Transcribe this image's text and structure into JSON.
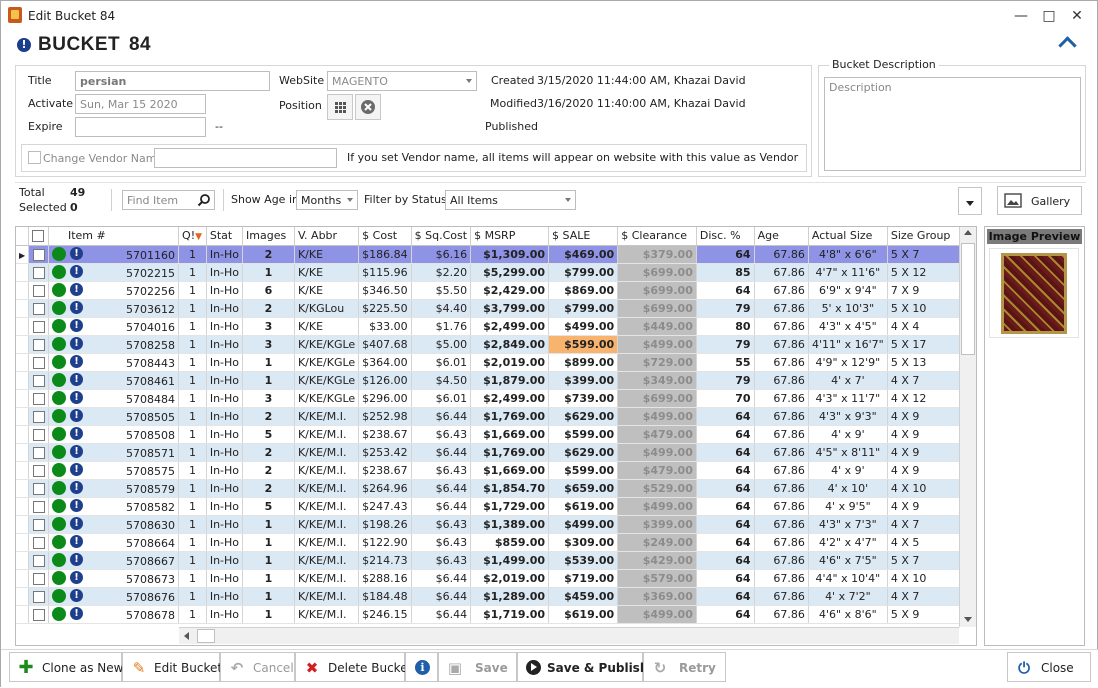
{
  "window": {
    "title": "Edit Bucket 84",
    "controls": [
      "—",
      "□",
      "✕"
    ]
  },
  "header": {
    "title": "BUCKET",
    "number": "84"
  },
  "form": {
    "title_label": "Title",
    "title_value": "persian",
    "activate_label": "Activate",
    "activate_value": "Sun, Mar 15 2020",
    "expire_label": "Expire",
    "expire_suffix": "--",
    "website_label": "WebSite",
    "website_value": "MAGENTO",
    "position_label": "Position",
    "created_label": "Created",
    "created_value": "3/15/2020 11:44:00 AM, Khazai David",
    "modified_label": "Modified",
    "modified_value": "3/16/2020 11:40:00 AM, Khazai David",
    "published_label": "Published",
    "change_vendor_label": "Change Vendor Name",
    "vendor_note": "If you set Vendor name, all items will appear on website with this value as Vendor",
    "description_group": "Bucket Description",
    "description_placeholder": "Description"
  },
  "toolbar": {
    "total_label": "Total",
    "total_value": "49",
    "selected_label": "Selected",
    "selected_value": "0",
    "find_placeholder": "Find Item",
    "show_age_label": "Show Age in",
    "age_unit": "Months",
    "filter_label": "Filter by Status",
    "filter_value": "All Items",
    "gallery_label": "Gallery"
  },
  "grid": {
    "columns": [
      "Item #",
      "Q!",
      "Stat",
      "Images",
      "V. Abbr",
      "$ Cost",
      "$ Sq.Cost",
      "$ MSRP",
      "$ SALE",
      "$ Clearance",
      "Disc. %",
      "Age",
      "Actual Size",
      "Size Group"
    ],
    "rows": [
      {
        "item": "5701160",
        "q": "1",
        "stat": "In-Ho",
        "images": "2",
        "vabbr": "K/KE",
        "cost": "$186.84",
        "sqcost": "$6.16",
        "msrp": "$1,309.00",
        "sale": "$469.00",
        "clearance": "$379.00",
        "disc": "64",
        "age": "67.86",
        "size": "4'8\" x 6'6\"",
        "group": "5 X 7"
      },
      {
        "item": "5702215",
        "q": "1",
        "stat": "In-Ho",
        "images": "1",
        "vabbr": "K/KE",
        "cost": "$115.96",
        "sqcost": "$2.20",
        "msrp": "$5,299.00",
        "sale": "$799.00",
        "clearance": "$699.00",
        "disc": "85",
        "age": "67.86",
        "size": "4'7\" x 11'6\"",
        "group": "5 X 12"
      },
      {
        "item": "5702256",
        "q": "1",
        "stat": "In-Ho",
        "images": "6",
        "vabbr": "K/KE",
        "cost": "$346.50",
        "sqcost": "$5.50",
        "msrp": "$2,429.00",
        "sale": "$869.00",
        "clearance": "$699.00",
        "disc": "64",
        "age": "67.86",
        "size": "6'9\" x 9'4\"",
        "group": "7 X 9"
      },
      {
        "item": "5703612",
        "q": "1",
        "stat": "In-Ho",
        "images": "2",
        "vabbr": "K/KGLou",
        "cost": "$225.50",
        "sqcost": "$4.40",
        "msrp": "$3,799.00",
        "sale": "$799.00",
        "clearance": "$699.00",
        "disc": "79",
        "age": "67.86",
        "size": "5' x 10'3\"",
        "group": "5 X 10"
      },
      {
        "item": "5704016",
        "q": "1",
        "stat": "In-Ho",
        "images": "3",
        "vabbr": "K/KE",
        "cost": "$33.00",
        "sqcost": "$1.76",
        "msrp": "$2,499.00",
        "sale": "$499.00",
        "clearance": "$449.00",
        "disc": "80",
        "age": "67.86",
        "size": "4'3\" x 4'5\"",
        "group": "4 X 4"
      },
      {
        "item": "5708258",
        "q": "1",
        "stat": "In-Ho",
        "images": "3",
        "vabbr": "K/KE/KGLe",
        "cost": "$407.68",
        "sqcost": "$5.00",
        "msrp": "$2,849.00",
        "sale": "$599.00",
        "clearance": "$499.00",
        "disc": "79",
        "age": "67.86",
        "size": "4'11\" x 16'7\"",
        "group": "5 X 17"
      },
      {
        "item": "5708443",
        "q": "1",
        "stat": "In-Ho",
        "images": "1",
        "vabbr": "K/KE/KGLe",
        "cost": "$364.00",
        "sqcost": "$6.01",
        "msrp": "$2,019.00",
        "sale": "$899.00",
        "clearance": "$729.00",
        "disc": "55",
        "age": "67.86",
        "size": "4'9\" x 12'9\"",
        "group": "5 X 13"
      },
      {
        "item": "5708461",
        "q": "1",
        "stat": "In-Ho",
        "images": "1",
        "vabbr": "K/KE/KGLe",
        "cost": "$126.00",
        "sqcost": "$4.50",
        "msrp": "$1,879.00",
        "sale": "$399.00",
        "clearance": "$349.00",
        "disc": "79",
        "age": "67.86",
        "size": "4' x 7'",
        "group": "4 X 7"
      },
      {
        "item": "5708484",
        "q": "1",
        "stat": "In-Ho",
        "images": "3",
        "vabbr": "K/KE/KGLe",
        "cost": "$296.00",
        "sqcost": "$6.01",
        "msrp": "$2,499.00",
        "sale": "$739.00",
        "clearance": "$699.00",
        "disc": "70",
        "age": "67.86",
        "size": "4'3\" x 11'7\"",
        "group": "4 X 12"
      },
      {
        "item": "5708505",
        "q": "1",
        "stat": "In-Ho",
        "images": "2",
        "vabbr": "K/KE/M.I.",
        "cost": "$252.98",
        "sqcost": "$6.44",
        "msrp": "$1,769.00",
        "sale": "$629.00",
        "clearance": "$499.00",
        "disc": "64",
        "age": "67.86",
        "size": "4'3\" x 9'3\"",
        "group": "4 X 9"
      },
      {
        "item": "5708508",
        "q": "1",
        "stat": "In-Ho",
        "images": "5",
        "vabbr": "K/KE/M.I.",
        "cost": "$238.67",
        "sqcost": "$6.43",
        "msrp": "$1,669.00",
        "sale": "$599.00",
        "clearance": "$479.00",
        "disc": "64",
        "age": "67.86",
        "size": "4' x 9'",
        "group": "4 X 9"
      },
      {
        "item": "5708571",
        "q": "1",
        "stat": "In-Ho",
        "images": "2",
        "vabbr": "K/KE/M.I.",
        "cost": "$253.42",
        "sqcost": "$6.44",
        "msrp": "$1,769.00",
        "sale": "$629.00",
        "clearance": "$499.00",
        "disc": "64",
        "age": "67.86",
        "size": "4'5\" x 8'11\"",
        "group": "4 X 9"
      },
      {
        "item": "5708575",
        "q": "1",
        "stat": "In-Ho",
        "images": "2",
        "vabbr": "K/KE/M.I.",
        "cost": "$238.67",
        "sqcost": "$6.43",
        "msrp": "$1,669.00",
        "sale": "$599.00",
        "clearance": "$479.00",
        "disc": "64",
        "age": "67.86",
        "size": "4' x 9'",
        "group": "4 X 9"
      },
      {
        "item": "5708579",
        "q": "1",
        "stat": "In-Ho",
        "images": "2",
        "vabbr": "K/KE/M.I.",
        "cost": "$264.96",
        "sqcost": "$6.44",
        "msrp": "$1,854.70",
        "sale": "$659.00",
        "clearance": "$529.00",
        "disc": "64",
        "age": "67.86",
        "size": "4' x 10'",
        "group": "4 X 10"
      },
      {
        "item": "5708582",
        "q": "1",
        "stat": "In-Ho",
        "images": "5",
        "vabbr": "K/KE/M.I.",
        "cost": "$247.43",
        "sqcost": "$6.44",
        "msrp": "$1,729.00",
        "sale": "$619.00",
        "clearance": "$499.00",
        "disc": "64",
        "age": "67.86",
        "size": "4' x 9'5\"",
        "group": "4 X 9"
      },
      {
        "item": "5708630",
        "q": "1",
        "stat": "In-Ho",
        "images": "1",
        "vabbr": "K/KE/M.I.",
        "cost": "$198.26",
        "sqcost": "$6.43",
        "msrp": "$1,389.00",
        "sale": "$499.00",
        "clearance": "$399.00",
        "disc": "64",
        "age": "67.86",
        "size": "4'3\" x 7'3\"",
        "group": "4 X 7"
      },
      {
        "item": "5708664",
        "q": "1",
        "stat": "In-Ho",
        "images": "1",
        "vabbr": "K/KE/M.I.",
        "cost": "$122.90",
        "sqcost": "$6.43",
        "msrp": "$859.00",
        "sale": "$309.00",
        "clearance": "$249.00",
        "disc": "64",
        "age": "67.86",
        "size": "4'2\" x 4'7\"",
        "group": "4 X 5"
      },
      {
        "item": "5708667",
        "q": "1",
        "stat": "In-Ho",
        "images": "1",
        "vabbr": "K/KE/M.I.",
        "cost": "$214.73",
        "sqcost": "$6.43",
        "msrp": "$1,499.00",
        "sale": "$539.00",
        "clearance": "$429.00",
        "disc": "64",
        "age": "67.86",
        "size": "4'6\" x 7'5\"",
        "group": "5 X 7"
      },
      {
        "item": "5708673",
        "q": "1",
        "stat": "In-Ho",
        "images": "1",
        "vabbr": "K/KE/M.I.",
        "cost": "$288.16",
        "sqcost": "$6.44",
        "msrp": "$2,019.00",
        "sale": "$719.00",
        "clearance": "$579.00",
        "disc": "64",
        "age": "67.86",
        "size": "4'4\" x 10'4\"",
        "group": "4 X 10"
      },
      {
        "item": "5708676",
        "q": "1",
        "stat": "In-Ho",
        "images": "1",
        "vabbr": "K/KE/M.I.",
        "cost": "$184.48",
        "sqcost": "$6.44",
        "msrp": "$1,289.00",
        "sale": "$459.00",
        "clearance": "$369.00",
        "disc": "64",
        "age": "67.86",
        "size": "4' x 7'2\"",
        "group": "4 X 7"
      },
      {
        "item": "5708678",
        "q": "1",
        "stat": "In-Ho",
        "images": "1",
        "vabbr": "K/KE/M.I.",
        "cost": "$246.15",
        "sqcost": "$6.44",
        "msrp": "$1,719.00",
        "sale": "$619.00",
        "clearance": "$499.00",
        "disc": "64",
        "age": "67.86",
        "size": "4'6\" x 8'6\"",
        "group": "5 X 9"
      }
    ]
  },
  "preview": {
    "header": "Image Preview"
  },
  "actions": {
    "clone": "Clone as New",
    "edit": "Edit Bucket",
    "cancel": "Cancel",
    "delete": "Delete Bucket",
    "save": "Save",
    "save_publish": "Save & Publish",
    "retry": "Retry",
    "close": "Close"
  },
  "colors": {
    "selected_row": "#8f93e6",
    "alt_row": "#dbe9f5",
    "clearance": "#bfbfbf",
    "highlight_sale": "#f8b36f",
    "status_green": "#0b8a1a",
    "info_blue": "#1f3f8c"
  }
}
